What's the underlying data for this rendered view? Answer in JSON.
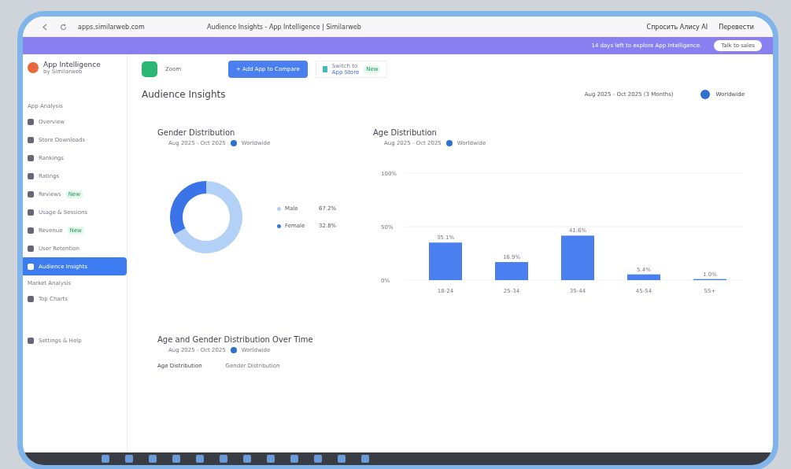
{
  "browser": {
    "address": "apps.similarweb.com",
    "tab_title": "Audience Insights - App Intelligence | Similarweb",
    "extensions": [
      "Спросить Алису AI",
      "Перевести"
    ]
  },
  "banner": {
    "text": "14 days left to explore App Intelligence.",
    "button": "Talk to sales"
  },
  "sidebar": {
    "logo": "App Intelligence",
    "logo_sub": "by Similarweb",
    "sections": [
      {
        "title": "App Analysis",
        "items": [
          {
            "label": "Overview",
            "selected": false
          },
          {
            "label": "Store Downloads",
            "selected": false
          },
          {
            "label": "Rankings",
            "selected": false
          },
          {
            "label": "Ratings",
            "selected": false
          },
          {
            "label": "Reviews",
            "badge": "New",
            "selected": false
          },
          {
            "label": "Usage & Sessions",
            "selected": false
          },
          {
            "label": "Revenue",
            "badge": "New",
            "selected": false
          },
          {
            "label": "User Retention",
            "selected": false
          },
          {
            "label": "Audience Insights",
            "selected": true
          }
        ]
      },
      {
        "title": "Market Analysis",
        "items": [
          {
            "label": "Top Charts",
            "selected": false
          }
        ]
      }
    ],
    "footer": "Settings & Help"
  },
  "toolbar": {
    "app_name": "Zoom",
    "add_button": "+ Add App to Compare",
    "switch_label": "Switch to",
    "switch_store": "App Store",
    "switch_badge": "New"
  },
  "page": {
    "title": "Audience Insights",
    "date_range": "Aug 2025 - Oct 2025 (3 Months)",
    "region": "Worldwide"
  },
  "gender": {
    "title": "Gender Distribution",
    "date": "Aug 2025 - Oct 2025",
    "region": "Worldwide",
    "legend": [
      {
        "value": "67.2%",
        "color": "#b3d1f7"
      },
      {
        "value": "32.8%",
        "color": "#3b74e8"
      }
    ],
    "chart_data": {
      "type": "donut",
      "categories": [
        "Male",
        "Female"
      ],
      "values": [
        67.2,
        32.8
      ]
    }
  },
  "age": {
    "title": "Age Distribution",
    "date": "Aug 2025 - Oct 2025",
    "region": "Worldwide",
    "chart_data": {
      "type": "bar",
      "categories": [
        "18-24",
        "25-34",
        "35-44",
        "45-54",
        "55+"
      ],
      "series": [
        {
          "color": "#4a7ff0",
          "values": [
            35.1,
            16.9,
            41.6,
            5.4,
            1.0
          ]
        }
      ],
      "ylim": [
        0,
        100
      ],
      "yticks": [
        {
          "value": 0,
          "label": "0%"
        },
        {
          "value": 50,
          "label": "50%"
        },
        {
          "value": 100,
          "label": "100%"
        }
      ],
      "value_labels": [
        "35.1%",
        "16.9%",
        "41.6%",
        "5.4%",
        "1.0%"
      ]
    }
  },
  "over_time": {
    "title": "Age and Gender Distribution Over Time",
    "date": "Aug 2025 - Oct 2025",
    "region": "Worldwide",
    "tabs": [
      {
        "label": "Age Distribution",
        "selected": true
      },
      {
        "label": "Gender Distribution",
        "selected": false
      }
    ]
  }
}
